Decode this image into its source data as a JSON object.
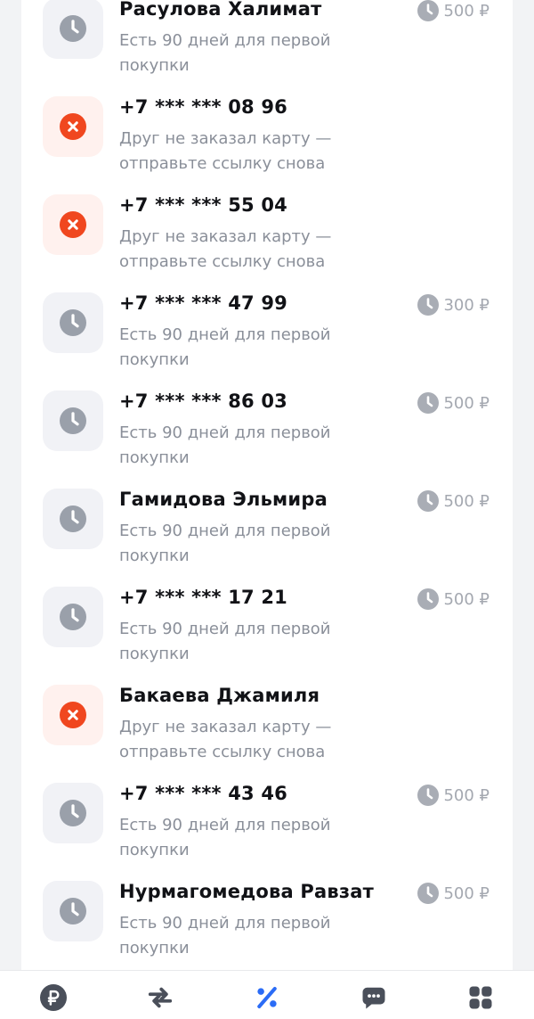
{
  "referrals": [
    {
      "status": "pending",
      "name": "Расулова Халимат",
      "subtitle": "Есть 90 дней для первой покупки",
      "reward": "500 ₽"
    },
    {
      "status": "failed",
      "name": "+7 *** *** 08 96",
      "subtitle": "Друг не заказал карту — отправьте ссылку снова",
      "reward": ""
    },
    {
      "status": "failed",
      "name": "+7 *** *** 55 04",
      "subtitle": "Друг не заказал карту — отправьте ссылку снова",
      "reward": ""
    },
    {
      "status": "pending",
      "name": "+7 *** *** 47 99",
      "subtitle": "Есть 90 дней для первой покупки",
      "reward": "300 ₽"
    },
    {
      "status": "pending",
      "name": "+7 *** *** 86 03",
      "subtitle": "Есть 90 дней для первой покупки",
      "reward": "500 ₽"
    },
    {
      "status": "pending",
      "name": "Гамидова Эльмира",
      "subtitle": "Есть 90 дней для первой покупки",
      "reward": "500 ₽"
    },
    {
      "status": "pending",
      "name": "+7 *** *** 17 21",
      "subtitle": "Есть 90 дней для первой покупки",
      "reward": "500 ₽"
    },
    {
      "status": "failed",
      "name": "Бакаева Джамиля",
      "subtitle": "Друг не заказал карту — отправьте ссылку снова",
      "reward": ""
    },
    {
      "status": "pending",
      "name": "+7 *** *** 43 46",
      "subtitle": "Есть 90 дней для первой покупки",
      "reward": "500 ₽"
    },
    {
      "status": "pending",
      "name": "Нурмагомедова Равзат",
      "subtitle": "Есть 90 дней для первой покупки",
      "reward": "500 ₽"
    }
  ],
  "tabbar": {
    "tabs": [
      {
        "icon": "ruble-icon",
        "active": false
      },
      {
        "icon": "transfer-arrows-icon",
        "active": false
      },
      {
        "icon": "percent-icon",
        "active": true
      },
      {
        "icon": "chat-icon",
        "active": false
      },
      {
        "icon": "grid-icon",
        "active": false
      }
    ]
  },
  "colors": {
    "active_tab": "#2b6cf6",
    "inactive_tab": "#4a4f5a",
    "error_red": "#f0471f",
    "pending_gray": "#9aa0aa"
  }
}
